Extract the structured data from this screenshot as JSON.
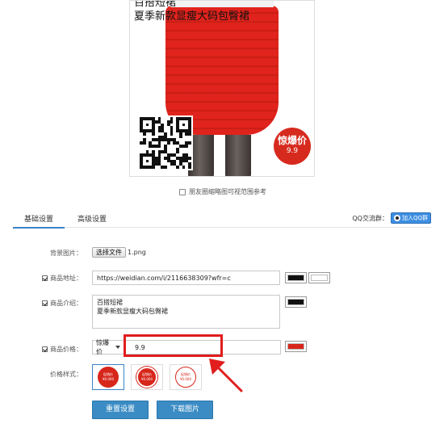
{
  "preview": {
    "title_line1": "百搭短裙",
    "title_line2": "夏季新款显瘦大码包臀裙",
    "badge_title": "惊爆价",
    "badge_price": "9.9",
    "qr_icon": "qr-code-icon"
  },
  "reference_checkbox_label": "朋友圈缩略图可视范围参考",
  "tabs": {
    "basic": "基础设置",
    "advanced": "高级设置"
  },
  "qq": {
    "label": "QQ交流群：",
    "button": "加入QQ群",
    "icon": "qq-penguin-icon"
  },
  "form": {
    "background_label": "背景图片：",
    "file_button": "选择文件",
    "file_name": "1.png",
    "url_label": "商品地址：",
    "url_value": "https://weidian.com/i/2116638309?wfr=c",
    "url_color": "#111111",
    "url_bg_color": "#ffffff",
    "desc_label": "商品介绍：",
    "desc_value": "百搭短裙\n夏季新款显瘦大码包臀裙",
    "desc_color": "#111111",
    "price_label": "商品价格：",
    "price_type": "惊爆价",
    "price_value": "9.9",
    "price_color": "#d7261a",
    "style_label": "价格样式：",
    "style_badge_title": "促销价",
    "style_badge_value": "¥0.000"
  },
  "buttons": {
    "reset": "重置设置",
    "download": "下载图片"
  },
  "colors": {
    "accent": "#3a84c9",
    "highlight": "#e11d1d",
    "badge": "#d7261a"
  }
}
